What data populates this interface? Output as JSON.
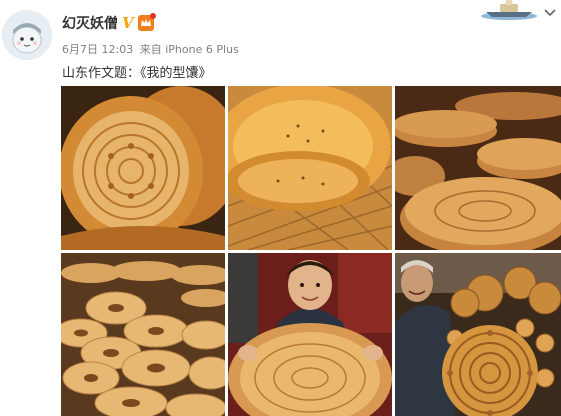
{
  "post": {
    "username": "幻灭妖僧",
    "verified_mark": "V",
    "time": "6月7日 12:03",
    "from_label": "来自",
    "source": "iPhone 6 Plus",
    "text": "山东作文题：《我的型馕》"
  },
  "icons": {
    "avatar": "cartoon-avatar",
    "verified": "verified-v-badge",
    "member": "member-badge-icon",
    "chevron": "chevron-down-icon",
    "header_illustration": "boat-illustration"
  },
  "colors": {
    "verified": "#f7a300",
    "member": "#f27f1b",
    "meta_text": "#808080",
    "body_text": "#333333"
  },
  "images": [
    {
      "name": "embossed-naan-stack"
    },
    {
      "name": "golden-naan-on-rack"
    },
    {
      "name": "naan-stack-market"
    },
    {
      "name": "bagel-naan-pile"
    },
    {
      "name": "boy-holding-naan"
    },
    {
      "name": "vendor-with-naan-display"
    }
  ]
}
